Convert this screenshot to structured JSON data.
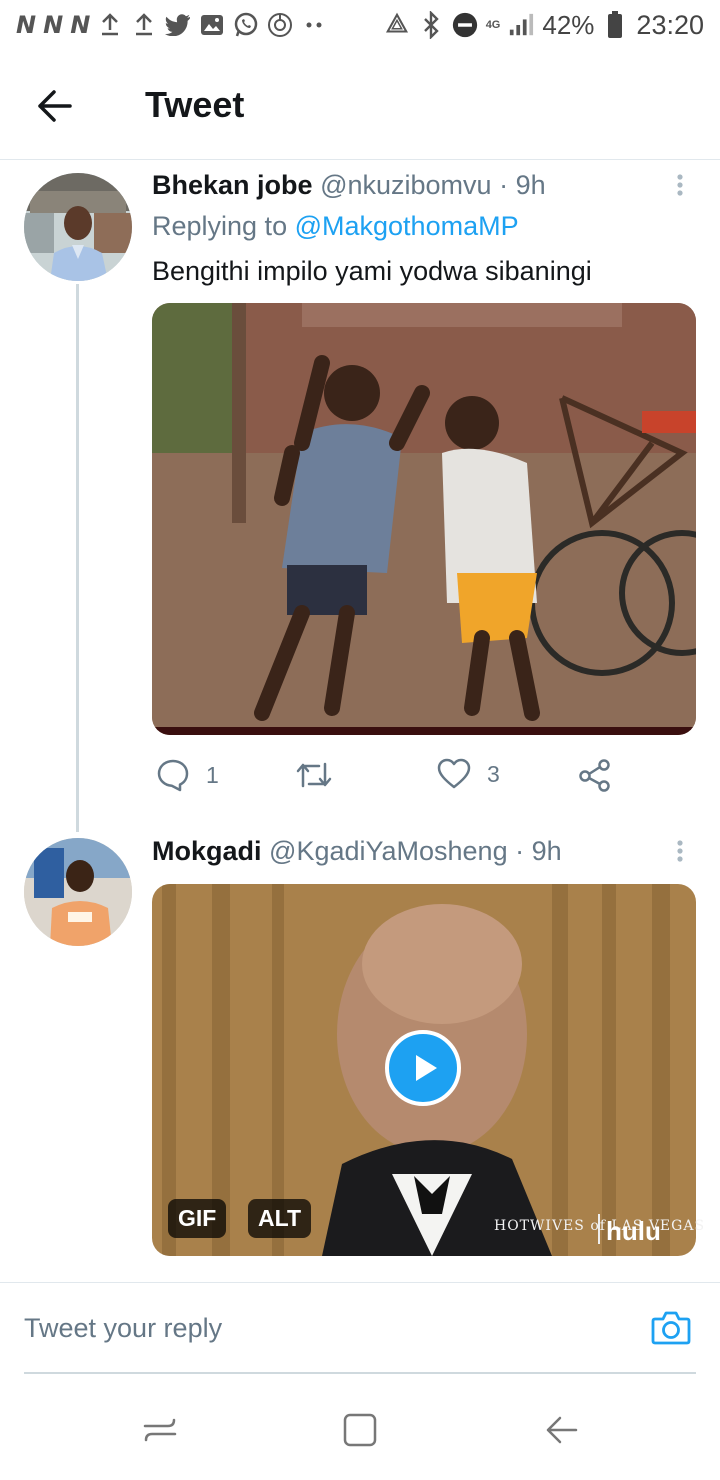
{
  "status_bar": {
    "carrier_icons": [
      "N",
      "N",
      "N"
    ],
    "left_icons": [
      "upload-icon",
      "upload-icon",
      "twitter-icon",
      "gallery-icon",
      "whatsapp-icon",
      "sync-icon",
      "dots-icon"
    ],
    "network": "4G",
    "battery": "42%",
    "time": "23:20"
  },
  "header": {
    "title": "Tweet"
  },
  "tweets": [
    {
      "display_name": "Bhekan jobe",
      "handle": "@nkuzibomvu",
      "separator": "·",
      "time": "9h",
      "replying_prefix": "Replying to",
      "replying_to": "@MakgothomaMP",
      "text": "Bengithi impilo yami yodwa sibaningi",
      "actions": {
        "reply_count": "1",
        "retweet_count": "",
        "like_count": "3"
      }
    },
    {
      "display_name": "Mokgadi",
      "handle": "@KgadiYaMosheng",
      "separator": "·",
      "time": "9h",
      "media_badges": {
        "gif": "GIF",
        "alt": "ALT"
      },
      "watermark": {
        "show": "HOTWIVES of LAS VEGAS",
        "brand": "hulu"
      }
    }
  ],
  "reply_bar": {
    "placeholder": "Tweet your reply"
  },
  "colors": {
    "accent": "#1da1f2",
    "secondary_text": "#657786",
    "primary_text": "#14171a",
    "divider": "#e1e8ed"
  }
}
